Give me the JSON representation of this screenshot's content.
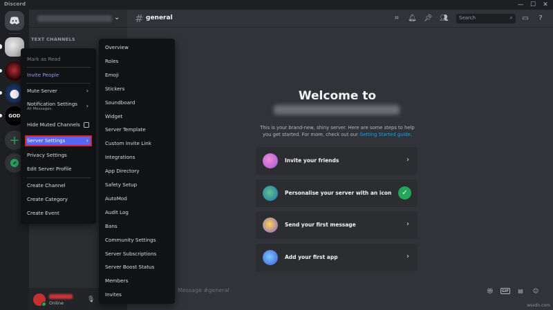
{
  "titlebar": {
    "brand": "Discord",
    "min": "—",
    "max": "☐",
    "close": "✕"
  },
  "rail": {
    "s4_label": "GOD"
  },
  "sidebar": {
    "category": "TEXT CHANNELS",
    "status": "Online"
  },
  "header": {
    "channel": "general",
    "search_placeholder": "Search"
  },
  "welcome": {
    "title": "Welcome to",
    "intro": "This is your brand-new, shiny server. Here are some steps to help you get started. For more, check out our",
    "intro_link": "Getting Started guide",
    "intro_end": "."
  },
  "cards": [
    {
      "label": "Invite your friends"
    },
    {
      "label": "Personalise your server with an icon"
    },
    {
      "label": "Send your first message"
    },
    {
      "label": "Add your first app"
    }
  ],
  "composer": {
    "placeholder": "Message #general",
    "gif": "GIF"
  },
  "watermark": "wsxdn.com",
  "menu1": {
    "mark_read": "Mark as Read",
    "invite": "Invite People",
    "mute": "Mute Server",
    "notif": "Notification Settings",
    "notif_sub": "All Messages",
    "hide_muted": "Hide Muted Channels",
    "server_settings": "Server Settings",
    "privacy": "Privacy Settings",
    "edit_profile": "Edit Server Profile",
    "create_channel": "Create Channel",
    "create_category": "Create Category",
    "create_event": "Create Event"
  },
  "menu2": [
    "Overview",
    "Roles",
    "Emoji",
    "Stickers",
    "Soundboard",
    "Widget",
    "Server Template",
    "Custom Invite Link",
    "Integrations",
    "App Directory",
    "Safety Setup",
    "AutoMod",
    "Audit Log",
    "Bans",
    "Community Settings",
    "Server Subscriptions",
    "Server Boost Status",
    "Members",
    "Invites"
  ]
}
